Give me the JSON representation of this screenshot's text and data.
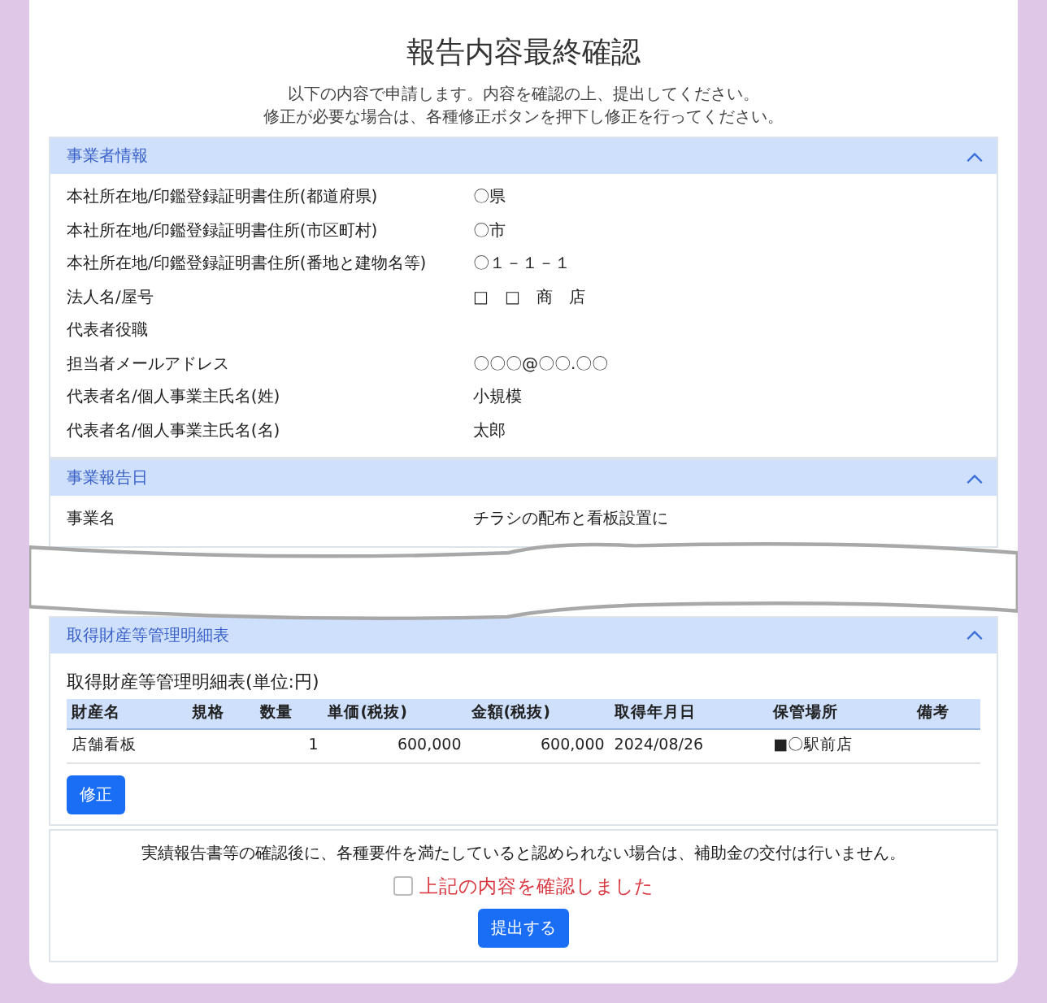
{
  "title": "報告内容最終確認",
  "intro": [
    "以下の内容で申請します。内容を確認の上、提出してください。",
    "修正が必要な場合は、各種修正ボタンを押下し修正を行ってください。"
  ],
  "sections": [
    {
      "heading": "事業者情報",
      "expanded": true,
      "rows": [
        {
          "label": "本社所在地/印鑑登録証明書住所(都道府県)",
          "value": "〇県"
        },
        {
          "label": "本社所在地/印鑑登録証明書住所(市区町村)",
          "value": "〇市"
        },
        {
          "label": "本社所在地/印鑑登録証明書住所(番地と建物名等)",
          "value": "〇１－１－１"
        },
        {
          "label": "法人名/屋号",
          "value": "□　□　商　店"
        },
        {
          "label": "代表者役職"
        },
        {
          "label": "担当者メールアドレス",
          "value": "〇〇〇@〇〇.〇〇"
        },
        {
          "label": "代表者名/個人事業主氏名(姓)",
          "value": "小規模"
        },
        {
          "label": "代表者名/個人事業主氏名(名)",
          "value": "太郎"
        }
      ]
    },
    {
      "heading": "事業報告日",
      "expanded": true,
      "rows": [
        {
          "label": "事業名",
          "value": "チラシの配布と看板設置に"
        }
      ]
    },
    {
      "heading": "取得財産等管理明細表",
      "expanded": true,
      "table": {
        "caption": "取得財産等管理明細表(単位:円)",
        "columns": [
          "財産名",
          "規格",
          "数量",
          "単価(税抜)",
          "金額(税抜)",
          "取得年月日",
          "保管場所",
          "備考"
        ],
        "rows": [
          {
            "cells": [
              "店舗看板",
              null,
              "1",
              "600,000",
              "600,000",
              "2024/08/26",
              "■〇駅前店",
              null
            ]
          }
        ]
      },
      "button": "修正"
    }
  ],
  "confirm": {
    "notice": "実績報告書等の確認後に、各種要件を満たしていると認められない場合は、補助金の交付は行いません。",
    "checkbox_label": "上記の内容を確認しました",
    "checked": false,
    "submit": "提出する"
  }
}
